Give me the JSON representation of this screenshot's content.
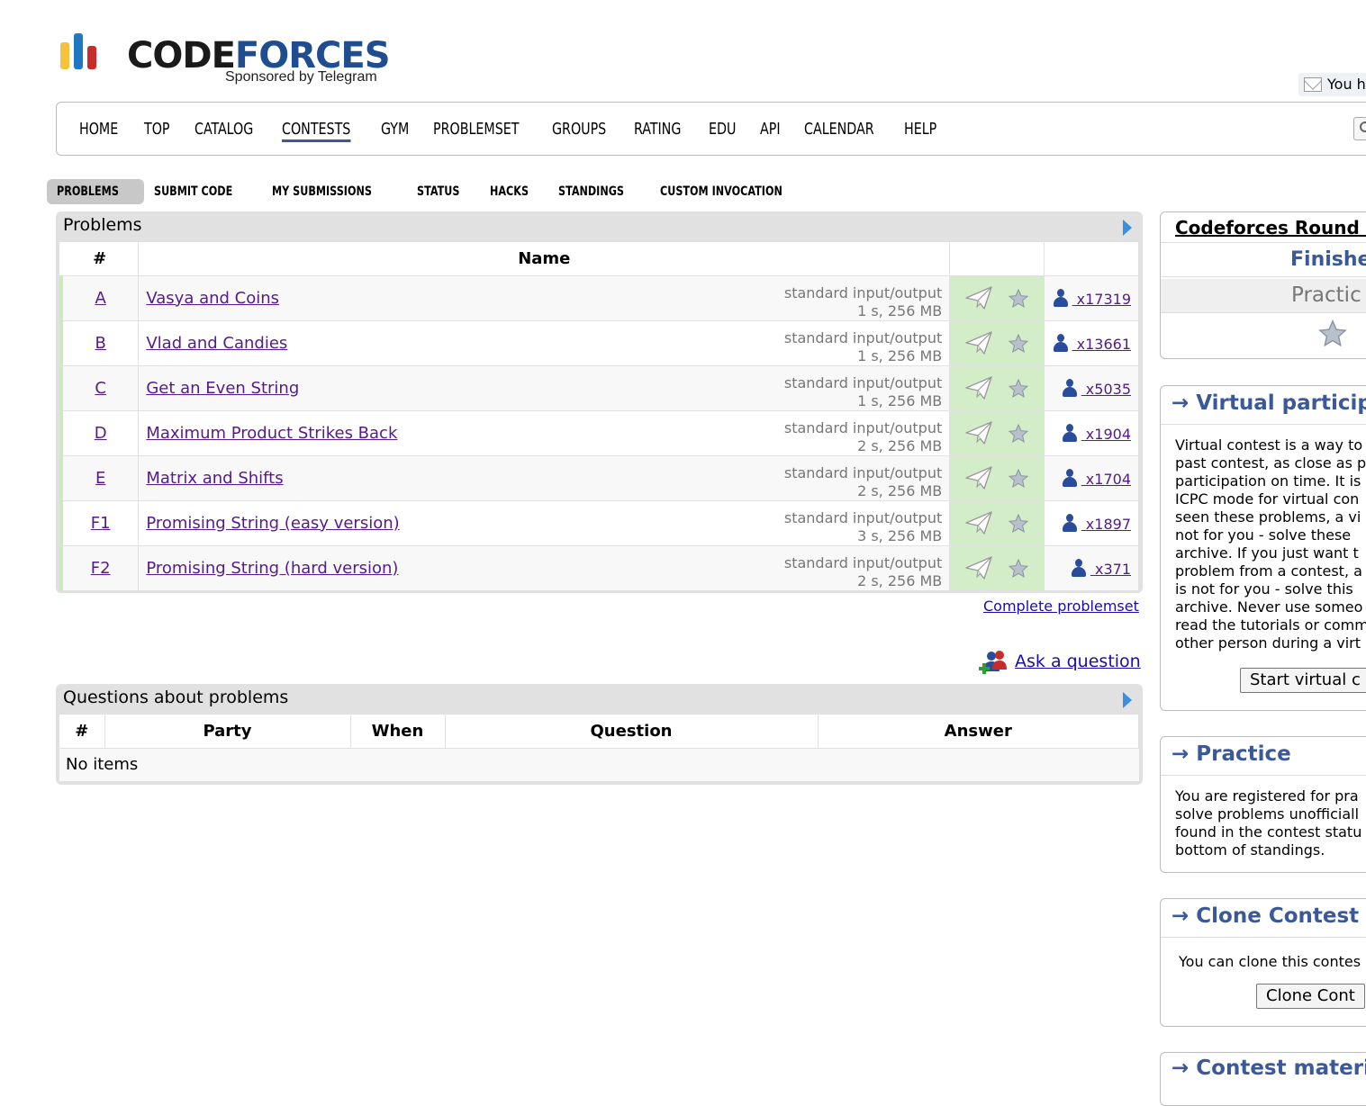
{
  "logo": {
    "word_part1": "CODE",
    "word_part2": "FORCES",
    "sponsor": "Sponsored by Telegram",
    "bar_colors": [
      "#f6c23e",
      "#1f78c1",
      "#c92a2a"
    ]
  },
  "header": {
    "mail_text": "You h"
  },
  "main_menu": {
    "items": [
      "HOME",
      "TOP",
      "CATALOG",
      "CONTESTS",
      "GYM",
      "PROBLEMSET",
      "GROUPS",
      "RATING",
      "EDU",
      "API",
      "CALENDAR",
      "HELP"
    ],
    "active": "CONTESTS"
  },
  "second_menu": {
    "items": [
      "PROBLEMS",
      "SUBMIT CODE",
      "MY SUBMISSIONS",
      "STATUS",
      "HACKS",
      "STANDINGS",
      "CUSTOM INVOCATION"
    ],
    "active": "PROBLEMS"
  },
  "problems": {
    "title": "Problems",
    "columns": {
      "index": "#",
      "name": "Name"
    },
    "rows": [
      {
        "index": "A",
        "name": "Vasya and Coins",
        "io": "standard input/output",
        "limits": "1 s, 256 MB",
        "solved": " x17319"
      },
      {
        "index": "B",
        "name": "Vlad and Candies",
        "io": "standard input/output",
        "limits": "1 s, 256 MB",
        "solved": " x13661"
      },
      {
        "index": "C",
        "name": "Get an Even String",
        "io": "standard input/output",
        "limits": "1 s, 256 MB",
        "solved": " x5035"
      },
      {
        "index": "D",
        "name": "Maximum Product Strikes Back",
        "io": "standard input/output",
        "limits": "2 s, 256 MB",
        "solved": " x1904"
      },
      {
        "index": "E",
        "name": "Matrix and Shifts",
        "io": "standard input/output",
        "limits": "2 s, 256 MB",
        "solved": " x1704"
      },
      {
        "index": "F1",
        "name": "Promising String (easy version)",
        "io": "standard input/output",
        "limits": "3 s, 256 MB",
        "solved": " x1897"
      },
      {
        "index": "F2",
        "name": "Promising String (hard version)",
        "io": "standard input/output",
        "limits": "2 s, 256 MB",
        "solved": " x371"
      }
    ],
    "complete_link": "Complete problemset",
    "ask_link": "Ask a question"
  },
  "questions": {
    "title": "Questions about problems",
    "columns": [
      "#",
      "Party",
      "When",
      "Question",
      "Answer"
    ],
    "empty_text": "No items"
  },
  "sidebar": {
    "contest": {
      "name": "Codeforces Round #",
      "phase": "Finishe",
      "practice": "Practic"
    },
    "virtual": {
      "title": "→ Virtual participa",
      "lines": [
        "Virtual contest is a way to",
        "past contest, as close as p",
        "participation on time. It is",
        "ICPC mode for virtual con",
        "seen these problems, a vi",
        "not for you - solve these",
        "archive. If you just want t",
        "problem from a contest, a",
        "is not for you - solve this",
        "archive. Never use someo",
        "read the tutorials or comm",
        "other person during a virt"
      ],
      "button": "Start virtual c"
    },
    "practice": {
      "title": "→ Practice",
      "lines": [
        "You are registered for pra",
        "solve problems unofficiall",
        "found in the contest statu",
        "bottom of standings."
      ]
    },
    "clone": {
      "title": "→ Clone Contest to",
      "text": "You can clone this contes",
      "button": "Clone Cont"
    },
    "materials": {
      "title": "→ Contest materia"
    }
  }
}
